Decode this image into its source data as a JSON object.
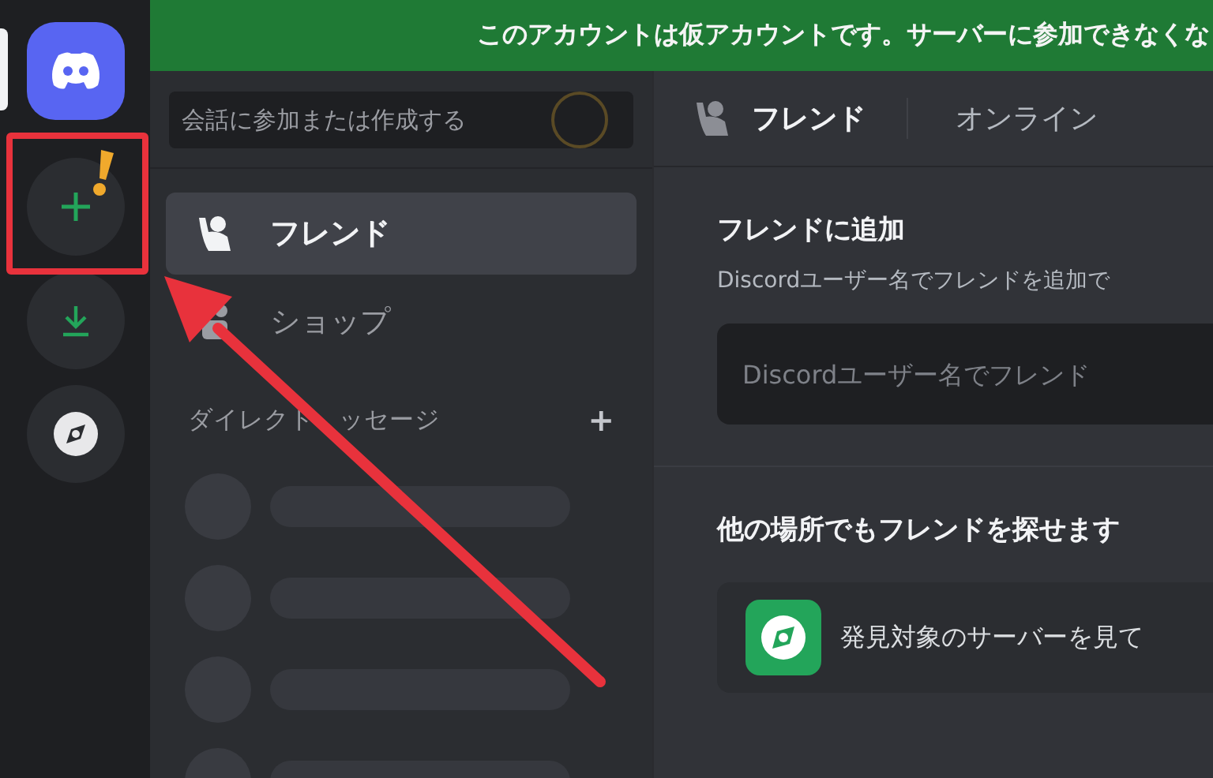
{
  "banner": {
    "text": "このアカウントは仮アカウントです。サーバーに参加できなくな"
  },
  "server_rail": [
    {
      "kind": "home",
      "selected": true
    },
    {
      "kind": "add",
      "selected": false
    },
    {
      "kind": "download",
      "selected": false
    },
    {
      "kind": "discover",
      "selected": false
    }
  ],
  "sidebar": {
    "search": {
      "placeholder": "会話に参加または作成する"
    },
    "items": [
      {
        "kind": "friends",
        "label": "フレンド",
        "selected": true
      },
      {
        "kind": "shop",
        "label": "ショップ",
        "selected": false
      }
    ],
    "section": {
      "label_parts": [
        "ダイレクト",
        "ッセージ"
      ],
      "action": "+"
    }
  },
  "header": {
    "title": "フレンド",
    "tabs": [
      {
        "label": "オンライン"
      }
    ]
  },
  "add_friend": {
    "title": "フレンドに追加",
    "description": "Discordユーザー名でフレンドを追加で",
    "input": {
      "placeholder": "Discordユーザー名でフレンド"
    }
  },
  "elsewhere": {
    "title": "他の場所でもフレンドを探せます",
    "cards": [
      {
        "kind": "discover",
        "label": "発見対象のサーバーを見て"
      }
    ]
  },
  "annotation": {
    "highlight": true,
    "arrow": true
  }
}
